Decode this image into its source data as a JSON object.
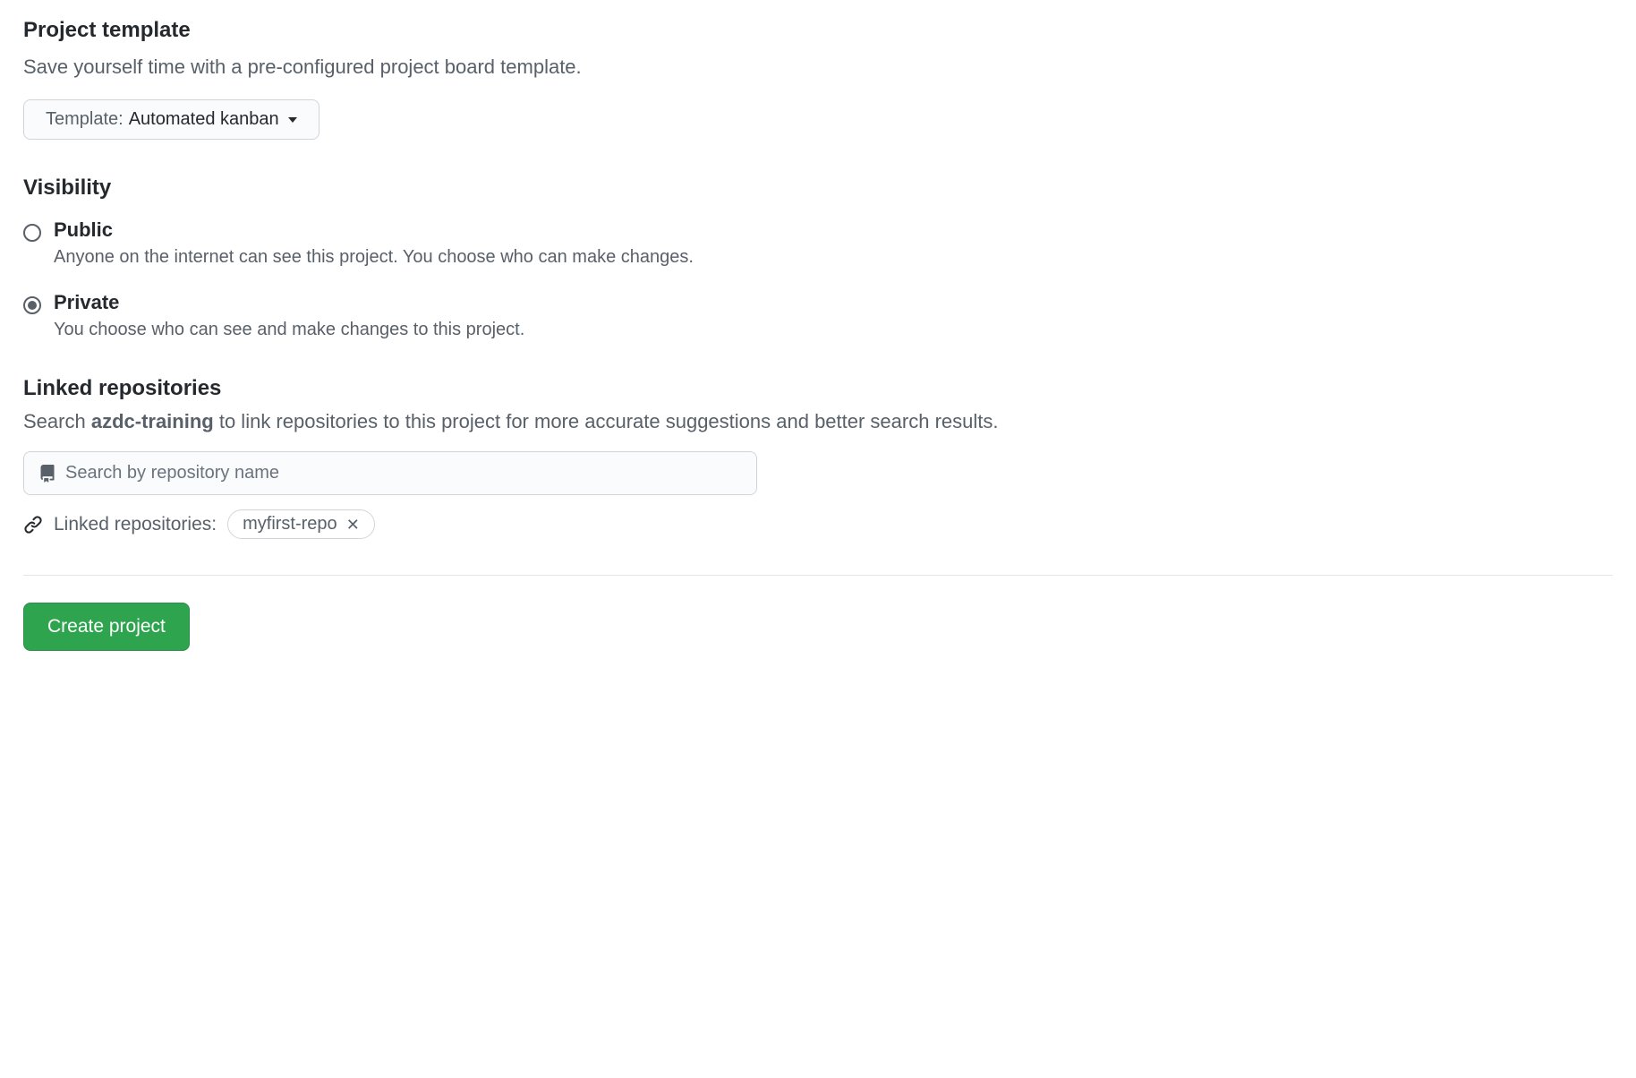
{
  "template_section": {
    "heading": "Project template",
    "description": "Save yourself time with a pre-configured project board template.",
    "selector_prefix": "Template: ",
    "selector_value": "Automated kanban"
  },
  "visibility_section": {
    "heading": "Visibility",
    "options": [
      {
        "label": "Public",
        "description": "Anyone on the internet can see this project. You choose who can make changes.",
        "selected": false
      },
      {
        "label": "Private",
        "description": "You choose who can see and make changes to this project.",
        "selected": true
      }
    ]
  },
  "linked_section": {
    "heading": "Linked repositories",
    "description_prefix": "Search ",
    "org_name": "azdc-training",
    "description_suffix": " to link repositories to this project for more accurate suggestions and better search results.",
    "search_placeholder": "Search by repository name",
    "linked_label": "Linked repositories:",
    "chips": [
      {
        "name": "myfirst-repo"
      }
    ]
  },
  "create_button_label": "Create project"
}
